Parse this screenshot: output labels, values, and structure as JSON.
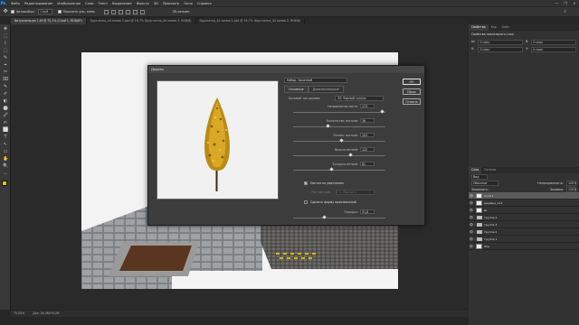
{
  "menu": {
    "logo": "Ps",
    "items": [
      "Файл",
      "Редактирование",
      "Изображение",
      "Слои",
      "Текст",
      "Выделение",
      "Фильтр",
      "3D",
      "Просмотр",
      "Окно",
      "Справка"
    ]
  },
  "window_controls": {
    "minimize": "—",
    "maximize": "❐",
    "close": "✕"
  },
  "options": {
    "autoselect_label": "Автовыбор:",
    "autoselect_value": "Слой",
    "show_controls_label": "Показать упр. элем.",
    "mode_3d": "3D-режим:",
    "search_icon": "⌕"
  },
  "tabs": [
    {
      "label": "Визуализация 1.tif @ 75,1% (Слой 1, RGB/8*)",
      "active": true
    },
    {
      "label": "Брусчатка_44 копия 3.psd @ 16,7% (Брусчатка_44 копия 3, RGB/8)",
      "active": false
    },
    {
      "label": "Брусчатка_44 копия 2.psd @ 16,7% (Брусчатка_44 копия 2, RGB/8)",
      "active": false
    }
  ],
  "tools": [
    "✥",
    "⬚",
    "⌇",
    "⬚",
    "✎",
    "⌖",
    "✂",
    "⌧",
    "✎",
    "✐",
    "◐",
    "⬤",
    "🖉",
    "✍",
    "⬜",
    "T",
    "↖",
    "▭",
    "✋",
    "🔍",
    "…"
  ],
  "status": {
    "zoom": "75,05%",
    "doc": "Док: 26,4M/76,0M"
  },
  "dialog": {
    "title": "Дерево",
    "preset_label": "Набор: Заказной",
    "tab_basic": "Основные",
    "tab_advanced": "Дополнительные",
    "base_type_label": "Базовый тип дерева:",
    "base_type_value": "33: Черный тополь",
    "sliders": [
      {
        "label": "Направление света:",
        "value": "173",
        "pos": 0.95
      },
      {
        "label": "Количество листьев:",
        "value": "36",
        "pos": 0.36
      },
      {
        "label": "Размер листьев:",
        "value": "103",
        "pos": 0.51
      },
      {
        "label": "Высота ветвей:",
        "value": "122",
        "pos": 0.61
      },
      {
        "label": "Толщина ветвей:",
        "value": "81",
        "pos": 0.4
      }
    ],
    "default_leaves_label": "Листья по умолчанию",
    "leaf_type_label": "Тип листьев:",
    "leaf_type_value": "1: Листья 1",
    "arbitrary_shape_label": "Сделать форму произвольной",
    "arrange_label": "Порядок:",
    "arrange_value": "31,8",
    "arrange_pos": 0.32,
    "ok": "OK",
    "reset": "Сброс",
    "cancel": "Отмена"
  },
  "right": {
    "top_tabs": [
      "Свойства",
      "Кор",
      "Библ"
    ],
    "props_title": "Свойства пиксельного слоя",
    "w_label": "Ш:",
    "w_value": "0 пикс",
    "h_label": "В:",
    "h_value": "0 пикс",
    "x_label": "X:",
    "x_value": "0 пикс",
    "y_label": "Y:",
    "y_value": "0 пикс",
    "layers_tabs": [
      "Слои",
      "Каналы"
    ],
    "kind_label": "Вид",
    "blend_mode": "Обычные",
    "opacity_label": "Непрозрачность:",
    "opacity_value": "100%",
    "lock_label": "Закрепить:",
    "fill_label": "Заливка:",
    "fill_value": "100%",
    "layers": [
      {
        "name": "Слой 1",
        "type": "pixel",
        "selected": true
      },
      {
        "name": "деревья_124",
        "type": "pixel",
        "selected": false
      },
      {
        "name": "Ш",
        "type": "pixel",
        "selected": false
      },
      {
        "name": "Группа 4",
        "type": "group",
        "selected": false
      },
      {
        "name": "Группа 3",
        "type": "group",
        "selected": false
      },
      {
        "name": "Группа 2",
        "type": "group",
        "selected": false
      },
      {
        "name": "Группа 1",
        "type": "group",
        "selected": false
      },
      {
        "name": "Фон",
        "type": "pixel",
        "selected": false
      }
    ]
  },
  "colors": {
    "fg": "#e8c200",
    "bg": "#ffffff",
    "selected_layer": "#5a5a5a"
  }
}
